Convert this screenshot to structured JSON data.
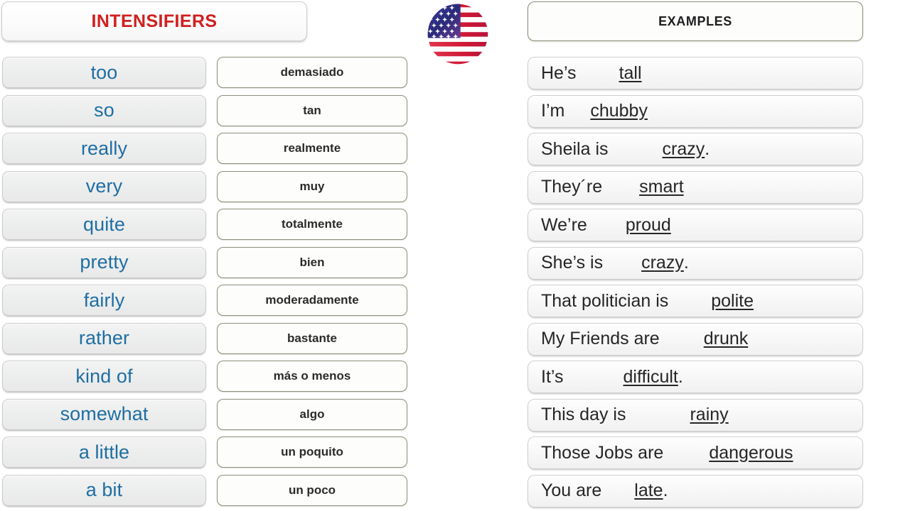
{
  "headers": {
    "intensifiers": "INTENSIFIERS",
    "examples": "EXAMPLES"
  },
  "flag": {
    "icon": "us-flag-circle-icon",
    "name": "United States flag"
  },
  "colors": {
    "title_red": "#d02020",
    "english_blue": "#1f6ea3",
    "spanish_black": "#2b2b2b",
    "example_text": "#262626",
    "english_card_fill": "#ecedec",
    "spanish_card_border": "#8b8f79",
    "page_background": "#ffffff"
  },
  "english": [
    {
      "word": "too"
    },
    {
      "word": "so"
    },
    {
      "word": "really"
    },
    {
      "word": "very"
    },
    {
      "word": "quite"
    },
    {
      "word": "pretty"
    },
    {
      "word": "fairly"
    },
    {
      "word": "rather"
    },
    {
      "word": "kind of"
    },
    {
      "word": "somewhat"
    },
    {
      "word": "a little"
    },
    {
      "word": "a bit"
    }
  ],
  "spanish": [
    {
      "word": "demasiado"
    },
    {
      "word": "tan"
    },
    {
      "word": "realmente"
    },
    {
      "word": "muy"
    },
    {
      "word": "totalmente"
    },
    {
      "word": "bien"
    },
    {
      "word": "moderadamente"
    },
    {
      "word": "bastante"
    },
    {
      "word": "más o menos"
    },
    {
      "word": "algo"
    },
    {
      "word": "un poquito"
    },
    {
      "word": "un poco"
    }
  ],
  "examples": [
    {
      "subject": "He’s",
      "blank": "tall",
      "period": ""
    },
    {
      "subject": "I’m",
      "blank": "chubby",
      "period": ""
    },
    {
      "subject": "Sheila is",
      "blank": "crazy",
      "period": "."
    },
    {
      "subject": "They´re",
      "blank": "smart",
      "period": ""
    },
    {
      "subject": "We’re",
      "blank": "proud",
      "period": ""
    },
    {
      "subject": "She’s is",
      "blank": "crazy",
      "period": "."
    },
    {
      "subject": "That politician is",
      "blank": "polite",
      "period": ""
    },
    {
      "subject": "My Friends are",
      "blank": "drunk",
      "period": ""
    },
    {
      "subject": "It’s",
      "blank": "difficult",
      "period": "."
    },
    {
      "subject": "This day is",
      "blank": "rainy",
      "period": ""
    },
    {
      "subject": "Those Jobs are",
      "blank": "dangerous",
      "period": ""
    },
    {
      "subject": "You are",
      "blank": "late",
      "period": "."
    }
  ]
}
